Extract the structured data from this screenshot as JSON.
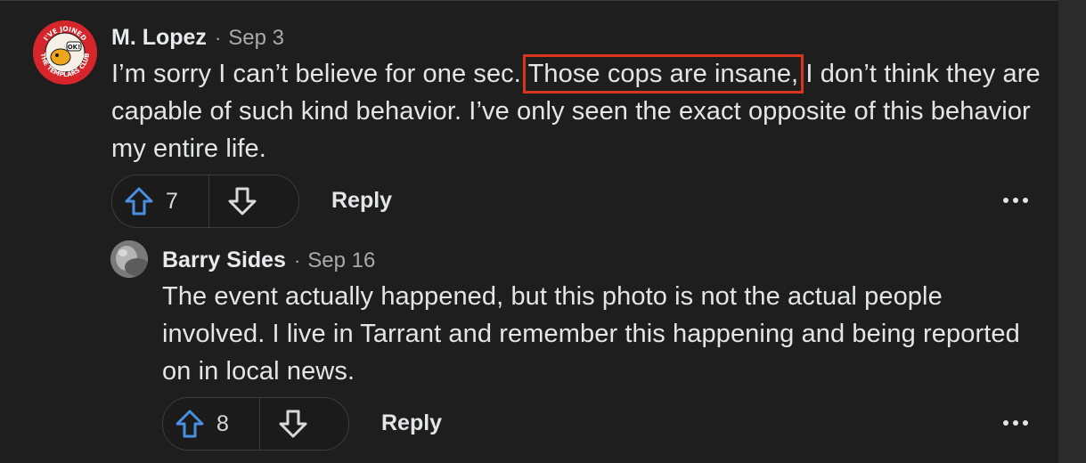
{
  "comments": [
    {
      "author": "M. Lopez",
      "separator": "·",
      "date": "Sep 3",
      "avatar_icon": "templars-club-badge-icon",
      "avatar_text_top": "I'VE JOINED",
      "avatar_text_bottom": "THE TEMPLARS CLUB",
      "avatar_badge": "OK!",
      "body_before": "I’m sorry I can’t believe for one sec. ",
      "body_highlight": "Those cops are insane,",
      "body_after": " I don’t think they are capable of such kind behavior. I’ve only seen the exact opposite of this behavior my entire life.",
      "votes": "7",
      "reply_label": "Reply"
    },
    {
      "author": "Barry Sides",
      "separator": "·",
      "date": "Sep 16",
      "avatar_icon": "user-avatar-icon",
      "body": "The event actually happened, but this photo is not the actual people involved. I live in Tarrant and remember this happening and being reported on in local news.",
      "votes": "8",
      "reply_label": "Reply"
    }
  ],
  "colors": {
    "background": "#1e1e1f",
    "highlight_border": "#d7361d",
    "upvote_icon": "#4a90e2",
    "text": "#e4e5e6",
    "muted": "#a8aaab"
  }
}
